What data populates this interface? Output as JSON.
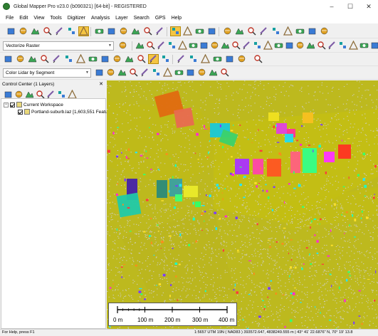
{
  "window": {
    "title": "Global Mapper Pro v23.0 (b090321) [64-bit] - REGISTERED",
    "minimize": "–",
    "maximize": "☐",
    "close": "✕"
  },
  "menu": [
    "File",
    "Edit",
    "View",
    "Tools",
    "Digitizer",
    "Analysis",
    "Layer",
    "Search",
    "GPS",
    "Help"
  ],
  "toolbar": {
    "vectorize_combo": "Vectorize Raster",
    "lidar_combo": "Color Lidar by Segment"
  },
  "control_center": {
    "title": "Control Center (1 Layers)",
    "close": "✕",
    "workspace_label": "Current Workspace",
    "layer_label": "Portland-suburb.laz [1,603,551 Featu"
  },
  "scale_bar": {
    "ticks": [
      "0 m",
      "100 m",
      "200 m",
      "300 m",
      "400 m"
    ]
  },
  "status": {
    "help": "For Help, press F1",
    "info": "1:5657  UTM 19N ( NAD83 ) 393572.647, 4838249.555 m | 43° 41' 22.6876\" N, 70° 19' 13.8"
  },
  "colors": {
    "map_background": "#bdb91e",
    "ground_points": "#c9c9c2",
    "accent_select": "#f5c542"
  },
  "icons": {
    "toolbar_row1": [
      "open-folder-icon",
      "globe-icon",
      "open-data-icon",
      "save-icon",
      "print-icon",
      "overlay-icon",
      "layers-icon",
      "pan-icon",
      "hand-icon",
      "zoom-in-icon",
      "zoom-out-icon",
      "back-icon",
      "home-icon",
      "digitize-icon",
      "edit-icon",
      "delete-icon",
      "move-icon",
      "measure-icon",
      "info-icon",
      "search-icon",
      "profile-icon",
      "terrain-icon",
      "view-icon",
      "map-icon",
      "chart-icon",
      "export-icon"
    ],
    "toolbar_row3": [
      "mountain-icon",
      "tree-icon",
      "water-icon",
      "line-icon",
      "ruler-icon",
      "grid-icon",
      "shape-icon",
      "filter-icon",
      "cut-icon",
      "refresh-icon",
      "target-icon",
      "play-icon",
      "stop-icon",
      "record-icon"
    ]
  }
}
